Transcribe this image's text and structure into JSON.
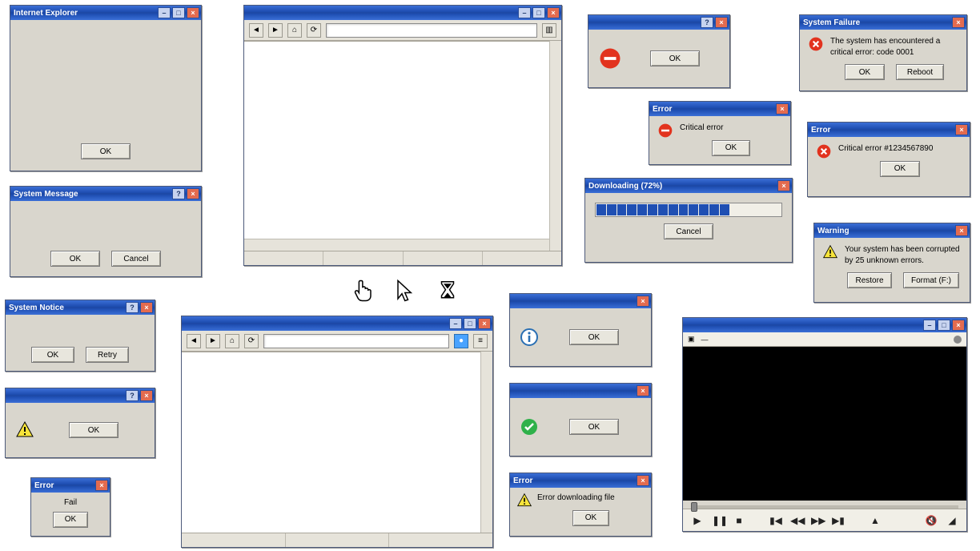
{
  "generic_ok": "OK",
  "generic_cancel": "Cancel",
  "generic_retry": "Retry",
  "min_glyph": "–",
  "max_glyph": "□",
  "close_glyph": "×",
  "help_glyph": "?",
  "w_blank_big": {
    "title": "Internet Explorer",
    "ok": "OK"
  },
  "w_sys_msg": {
    "title": "System Message",
    "ok": "OK",
    "cancel": "Cancel"
  },
  "w_sys_notice": {
    "title": "System Notice",
    "ok": "OK",
    "retry": "Retry"
  },
  "w_warn_small": {
    "title": "",
    "ok": "OK"
  },
  "w_tiny": {
    "title": "Error",
    "text": "Fail",
    "ok": "OK"
  },
  "w_browser1": {
    "title": ""
  },
  "w_browser2": {
    "title": ""
  },
  "w_stop": {
    "title": "",
    "ok": "OK"
  },
  "w_crit": {
    "title": "Error",
    "text": "Critical error",
    "ok": "OK"
  },
  "w_progress": {
    "title": "Downloading (72%)",
    "cancel": "Cancel",
    "percent": 72,
    "blocks_total": 18,
    "blocks_filled": 13
  },
  "w_info": {
    "title": "",
    "ok": "OK"
  },
  "w_success": {
    "title": "",
    "ok": "OK"
  },
  "w_dl_err": {
    "title": "Error",
    "text": "Error downloading file",
    "ok": "OK"
  },
  "w_sys_fail": {
    "title": "System Failure",
    "text": "The system has encountered a critical error: code 0001",
    "ok": "OK",
    "reboot": "Reboot"
  },
  "w_crit_hash": {
    "title": "Error",
    "text": "Critical error #1234567890",
    "ok": "OK"
  },
  "w_corrupt": {
    "title": "Warning",
    "text": "Your system has been corrupted by 25 unknown errors.",
    "restore": "Restore",
    "format": "Format (F:)"
  },
  "w_media": {
    "title": ""
  },
  "cursor_hand": "hand-cursor-icon",
  "cursor_arrow": "arrow-cursor-icon",
  "cursor_wait": "hourglass-cursor-icon"
}
